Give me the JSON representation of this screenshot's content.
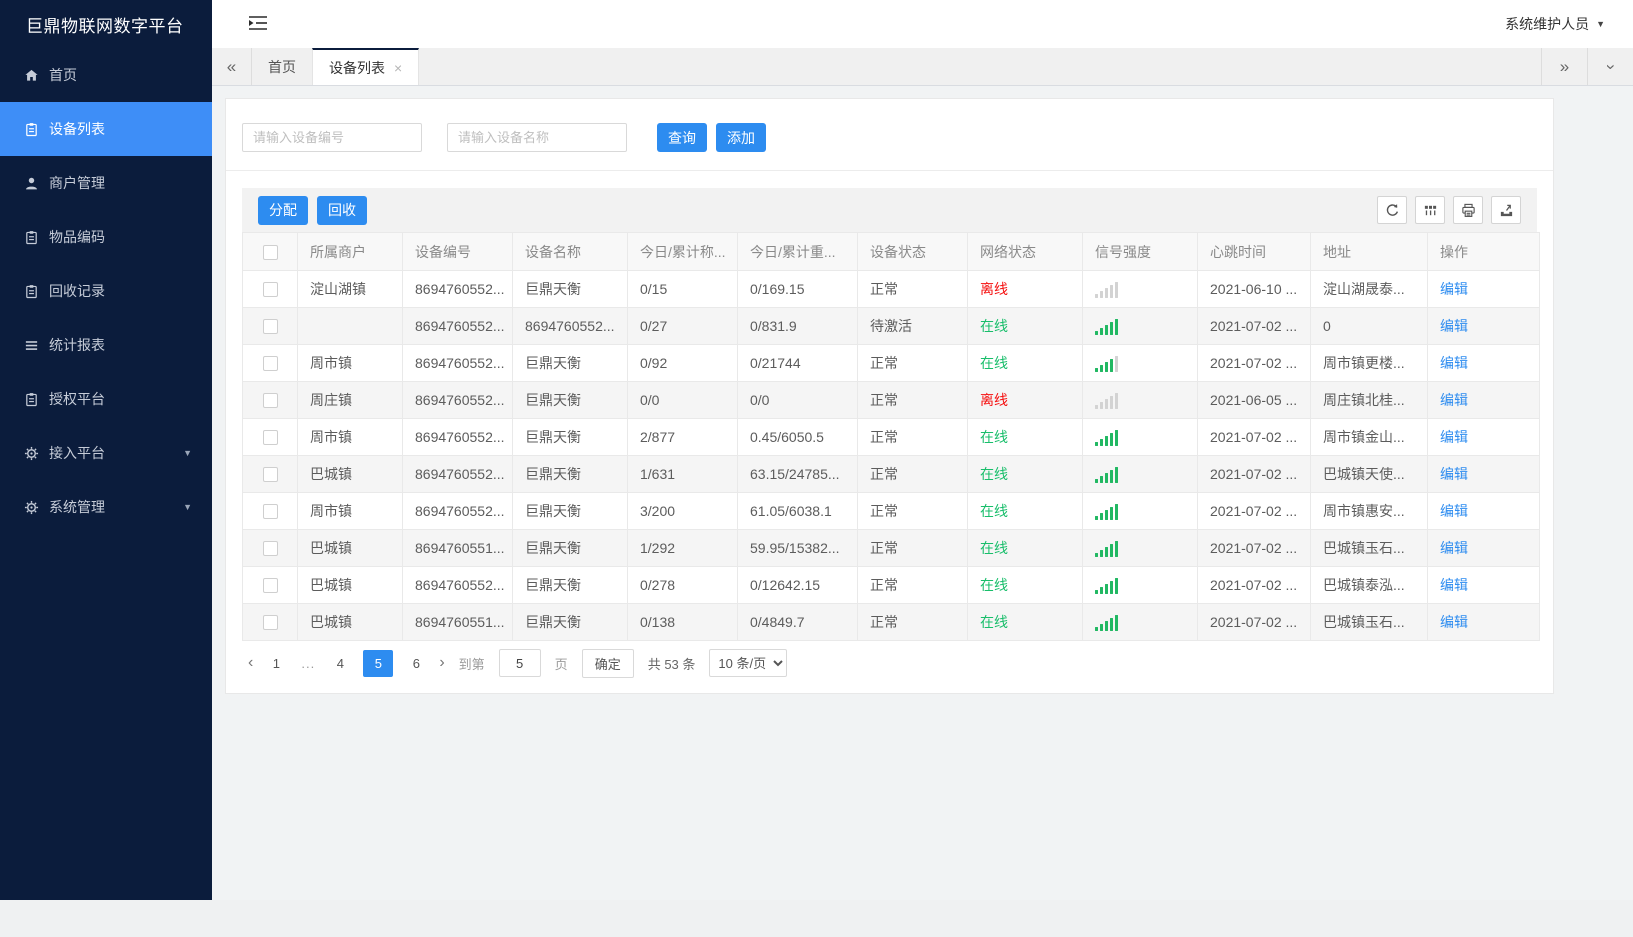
{
  "app": {
    "title": "巨鼎物联网数字平台",
    "user_name": "系统维护人员"
  },
  "sidebar": {
    "items": [
      {
        "label": "首页",
        "icon": "home-icon",
        "active": false,
        "expandable": false
      },
      {
        "label": "设备列表",
        "icon": "clipboard-icon",
        "active": true,
        "expandable": false
      },
      {
        "label": "商户管理",
        "icon": "user-icon",
        "active": false,
        "expandable": false
      },
      {
        "label": "物品编码",
        "icon": "clipboard-icon",
        "active": false,
        "expandable": false
      },
      {
        "label": "回收记录",
        "icon": "clipboard-icon",
        "active": false,
        "expandable": false
      },
      {
        "label": "统计报表",
        "icon": "lines-icon",
        "active": false,
        "expandable": false
      },
      {
        "label": "授权平台",
        "icon": "clipboard-icon",
        "active": false,
        "expandable": false
      },
      {
        "label": "接入平台",
        "icon": "gear-icon",
        "active": false,
        "expandable": true
      },
      {
        "label": "系统管理",
        "icon": "gear-icon",
        "active": false,
        "expandable": true
      }
    ]
  },
  "tabs": {
    "items": [
      {
        "label": "首页",
        "active": false,
        "closable": false
      },
      {
        "label": "设备列表",
        "active": true,
        "closable": true
      }
    ]
  },
  "search": {
    "device_no_placeholder": "请输入设备编号",
    "device_name_placeholder": "请输入设备名称",
    "query_label": "查询",
    "add_label": "添加"
  },
  "toolbar": {
    "assign_label": "分配",
    "recycle_label": "回收",
    "icons": [
      "refresh-icon",
      "columns-icon",
      "print-icon",
      "export-icon"
    ]
  },
  "table": {
    "columns": [
      "所属商户",
      "设备编号",
      "设备名称",
      "今日/累计称...",
      "今日/累计重...",
      "设备状态",
      "网络状态",
      "信号强度",
      "心跳时间",
      "地址",
      "操作"
    ],
    "rows": [
      {
        "merchant": "淀山湖镇",
        "device_no": "8694760552...",
        "device_name": "巨鼎天衡",
        "today_count": "0/15",
        "today_weight": "0/169.15",
        "device_status": "正常",
        "network_status": "离线",
        "online": false,
        "signal_level": 0,
        "heartbeat": "2021-06-10 ...",
        "address": "淀山湖晟泰...",
        "action": "编辑"
      },
      {
        "merchant": "",
        "device_no": "8694760552...",
        "device_name": "8694760552...",
        "today_count": "0/27",
        "today_weight": "0/831.9",
        "device_status": "待激活",
        "network_status": "在线",
        "online": true,
        "signal_level": 5,
        "heartbeat": "2021-07-02 ...",
        "address": "0",
        "action": "编辑"
      },
      {
        "merchant": "周市镇",
        "device_no": "8694760552...",
        "device_name": "巨鼎天衡",
        "today_count": "0/92",
        "today_weight": "0/21744",
        "device_status": "正常",
        "network_status": "在线",
        "online": true,
        "signal_level": 4,
        "heartbeat": "2021-07-02 ...",
        "address": "周市镇更楼...",
        "action": "编辑"
      },
      {
        "merchant": "周庄镇",
        "device_no": "8694760552...",
        "device_name": "巨鼎天衡",
        "today_count": "0/0",
        "today_weight": "0/0",
        "device_status": "正常",
        "network_status": "离线",
        "online": false,
        "signal_level": 0,
        "heartbeat": "2021-06-05 ...",
        "address": "周庄镇北桂...",
        "action": "编辑"
      },
      {
        "merchant": "周市镇",
        "device_no": "8694760552...",
        "device_name": "巨鼎天衡",
        "today_count": "2/877",
        "today_weight": "0.45/6050.5",
        "device_status": "正常",
        "network_status": "在线",
        "online": true,
        "signal_level": 5,
        "heartbeat": "2021-07-02 ...",
        "address": "周市镇金山...",
        "action": "编辑"
      },
      {
        "merchant": "巴城镇",
        "device_no": "8694760552...",
        "device_name": "巨鼎天衡",
        "today_count": "1/631",
        "today_weight": "63.15/24785...",
        "device_status": "正常",
        "network_status": "在线",
        "online": true,
        "signal_level": 5,
        "heartbeat": "2021-07-02 ...",
        "address": "巴城镇天使...",
        "action": "编辑"
      },
      {
        "merchant": "周市镇",
        "device_no": "8694760552...",
        "device_name": "巨鼎天衡",
        "today_count": "3/200",
        "today_weight": "61.05/6038.1",
        "device_status": "正常",
        "network_status": "在线",
        "online": true,
        "signal_level": 5,
        "heartbeat": "2021-07-02 ...",
        "address": "周市镇惠安...",
        "action": "编辑"
      },
      {
        "merchant": "巴城镇",
        "device_no": "8694760551...",
        "device_name": "巨鼎天衡",
        "today_count": "1/292",
        "today_weight": "59.95/15382...",
        "device_status": "正常",
        "network_status": "在线",
        "online": true,
        "signal_level": 5,
        "heartbeat": "2021-07-02 ...",
        "address": "巴城镇玉石...",
        "action": "编辑"
      },
      {
        "merchant": "巴城镇",
        "device_no": "8694760552...",
        "device_name": "巨鼎天衡",
        "today_count": "0/278",
        "today_weight": "0/12642.15",
        "device_status": "正常",
        "network_status": "在线",
        "online": true,
        "signal_level": 5,
        "heartbeat": "2021-07-02 ...",
        "address": "巴城镇泰泓...",
        "action": "编辑"
      },
      {
        "merchant": "巴城镇",
        "device_no": "8694760551...",
        "device_name": "巨鼎天衡",
        "today_count": "0/138",
        "today_weight": "0/4849.7",
        "device_status": "正常",
        "network_status": "在线",
        "online": true,
        "signal_level": 5,
        "heartbeat": "2021-07-02 ...",
        "address": "巴城镇玉石...",
        "action": "编辑"
      }
    ]
  },
  "pagination": {
    "prev": "‹",
    "next": "›",
    "pages": [
      "1",
      "...",
      "4",
      "5",
      "6"
    ],
    "active_page": "5",
    "goto_label": "到第",
    "goto_value": "5",
    "page_unit": "页",
    "confirm_label": "确定",
    "total_text": "共 53 条",
    "page_size_value": "10 条/页"
  },
  "colors": {
    "sidebar_bg": "#0b1c3c",
    "primary_blue": "#2d8cf0",
    "sidebar_active_blue": "#3e8ef7",
    "online_green": "#19be6b",
    "offline_red": "#f50f0f",
    "signal_on": "#21b862",
    "signal_off": "#d3d3d3"
  }
}
